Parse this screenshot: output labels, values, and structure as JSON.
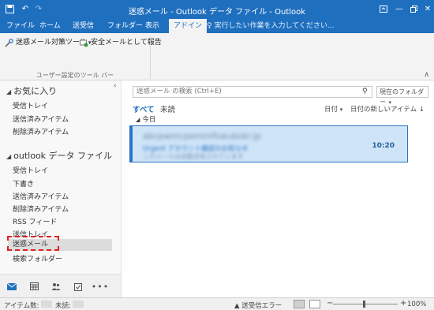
{
  "window": {
    "title": "迷惑メール - Outlook データ ファイル - Outlook",
    "undo_icon": "undo-icon",
    "save_icon": "save-icon",
    "controls": [
      "ribbon-display-icon",
      "minimize-icon",
      "restore-icon",
      "close-icon"
    ]
  },
  "ribbon_tabs": [
    "ファイル",
    "ホーム",
    "送受信",
    "フォルダー",
    "表示",
    "アドイン"
  ],
  "active_tab": "アドイン",
  "tell_me": "実行したい作業を入力してください...",
  "ribbon": {
    "buttons": [
      "迷惑メール対策ツール",
      "安全メールとして報告"
    ],
    "group_label": "ユーザー設定のツール バー"
  },
  "sidebar": {
    "favorites_title": "お気に入り",
    "favorites": [
      "受信トレイ",
      "送信済みアイテム",
      "削除済みアイテム"
    ],
    "datafile_title": "outlook データ ファイル",
    "folders": [
      "受信トレイ",
      "下書き",
      "送信済みアイテム",
      "削除済みアイテム",
      "RSS フィード",
      "送信トレイ",
      "迷惑メール",
      "検索フォルダー"
    ],
    "selected": "迷惑メール",
    "nav_icons": [
      "mail-icon",
      "calendar-icon",
      "people-icon",
      "tasks-icon",
      "more-icon"
    ]
  },
  "search": {
    "placeholder": "迷惑メール の検索 (Ctrl+E)",
    "scope": "現在のフォルダー"
  },
  "list": {
    "filter_all": "すべて",
    "filter_unread": "未読",
    "sort_by": "日付",
    "sort_order": "日付の新しいアイテム",
    "group_today": "今日",
    "message": {
      "from": "abcpwmcpemrnfswubskr.jp",
      "subject": "Urgent  アカウント確認のお知らせ",
      "preview": "このメールは自動送信されています",
      "time": "10:20"
    }
  },
  "status": {
    "items_label": "アイテム数:",
    "unread_label": "未読:",
    "send_error": "送受信エラー",
    "zoom": "100%"
  },
  "colors": {
    "accent": "#1f6fbf",
    "selected_message_bg": "#cfe4f7",
    "highlight_box": "#e02020"
  }
}
